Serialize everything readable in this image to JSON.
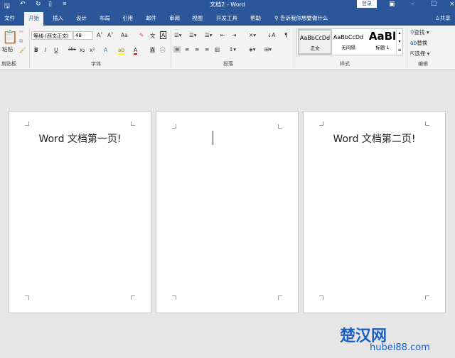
{
  "title": "文档2 - Word",
  "login": "登录",
  "tabs": [
    "文件",
    "开始",
    "插入",
    "设计",
    "布局",
    "引用",
    "邮件",
    "审阅",
    "视图",
    "开发工具",
    "帮助"
  ],
  "tell_me": "告诉我你想要做什么",
  "share": "共享",
  "clipboard": {
    "paste": "粘贴",
    "group": "剪贴板"
  },
  "font": {
    "name": "等线 (西文正文)",
    "size": "48",
    "case": "Aa",
    "group": "字体"
  },
  "paragraph": {
    "group": "段落"
  },
  "styles": {
    "items": [
      {
        "preview": "AaBbCcDd",
        "name": "正文"
      },
      {
        "preview": "AaBbCcDd",
        "name": "无间隔"
      },
      {
        "preview": "AaBl",
        "name": "标题 1"
      }
    ],
    "group": "样式"
  },
  "editing": {
    "find": "查找",
    "replace": "替换",
    "select": "选择",
    "group": "编辑"
  },
  "pages": [
    {
      "text": "Word 文档第一页!"
    },
    {
      "text": ""
    },
    {
      "text": "Word 文档第二页!"
    }
  ],
  "watermark": {
    "name": "楚汉网",
    "url": "hubei88.com"
  },
  "colors": {
    "brand": "#2b579a",
    "ribbon": "#f3f3f3",
    "canvas": "#e6e6e6"
  }
}
